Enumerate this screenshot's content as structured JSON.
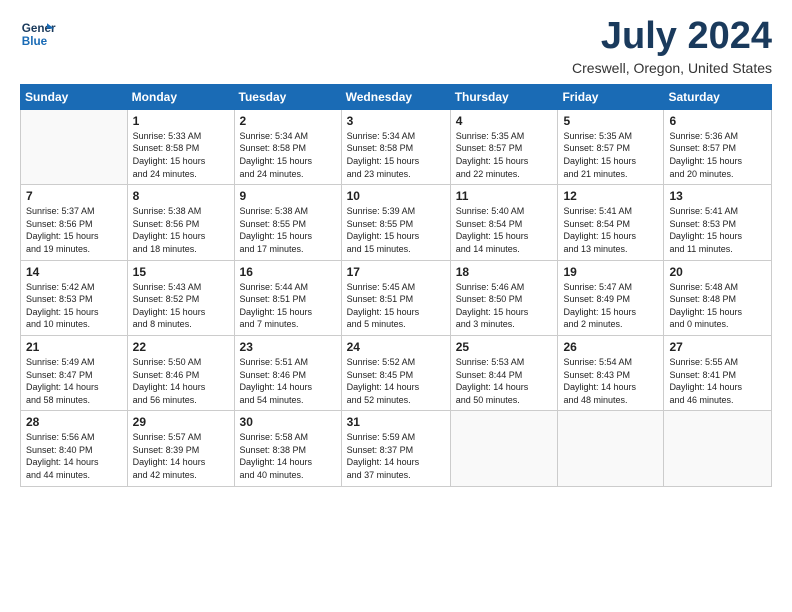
{
  "header": {
    "logo_line1": "General",
    "logo_line2": "Blue",
    "month_title": "July 2024",
    "location": "Creswell, Oregon, United States"
  },
  "weekdays": [
    "Sunday",
    "Monday",
    "Tuesday",
    "Wednesday",
    "Thursday",
    "Friday",
    "Saturday"
  ],
  "weeks": [
    [
      {
        "num": "",
        "info": ""
      },
      {
        "num": "1",
        "info": "Sunrise: 5:33 AM\nSunset: 8:58 PM\nDaylight: 15 hours\nand 24 minutes."
      },
      {
        "num": "2",
        "info": "Sunrise: 5:34 AM\nSunset: 8:58 PM\nDaylight: 15 hours\nand 24 minutes."
      },
      {
        "num": "3",
        "info": "Sunrise: 5:34 AM\nSunset: 8:58 PM\nDaylight: 15 hours\nand 23 minutes."
      },
      {
        "num": "4",
        "info": "Sunrise: 5:35 AM\nSunset: 8:57 PM\nDaylight: 15 hours\nand 22 minutes."
      },
      {
        "num": "5",
        "info": "Sunrise: 5:35 AM\nSunset: 8:57 PM\nDaylight: 15 hours\nand 21 minutes."
      },
      {
        "num": "6",
        "info": "Sunrise: 5:36 AM\nSunset: 8:57 PM\nDaylight: 15 hours\nand 20 minutes."
      }
    ],
    [
      {
        "num": "7",
        "info": "Sunrise: 5:37 AM\nSunset: 8:56 PM\nDaylight: 15 hours\nand 19 minutes."
      },
      {
        "num": "8",
        "info": "Sunrise: 5:38 AM\nSunset: 8:56 PM\nDaylight: 15 hours\nand 18 minutes."
      },
      {
        "num": "9",
        "info": "Sunrise: 5:38 AM\nSunset: 8:55 PM\nDaylight: 15 hours\nand 17 minutes."
      },
      {
        "num": "10",
        "info": "Sunrise: 5:39 AM\nSunset: 8:55 PM\nDaylight: 15 hours\nand 15 minutes."
      },
      {
        "num": "11",
        "info": "Sunrise: 5:40 AM\nSunset: 8:54 PM\nDaylight: 15 hours\nand 14 minutes."
      },
      {
        "num": "12",
        "info": "Sunrise: 5:41 AM\nSunset: 8:54 PM\nDaylight: 15 hours\nand 13 minutes."
      },
      {
        "num": "13",
        "info": "Sunrise: 5:41 AM\nSunset: 8:53 PM\nDaylight: 15 hours\nand 11 minutes."
      }
    ],
    [
      {
        "num": "14",
        "info": "Sunrise: 5:42 AM\nSunset: 8:53 PM\nDaylight: 15 hours\nand 10 minutes."
      },
      {
        "num": "15",
        "info": "Sunrise: 5:43 AM\nSunset: 8:52 PM\nDaylight: 15 hours\nand 8 minutes."
      },
      {
        "num": "16",
        "info": "Sunrise: 5:44 AM\nSunset: 8:51 PM\nDaylight: 15 hours\nand 7 minutes."
      },
      {
        "num": "17",
        "info": "Sunrise: 5:45 AM\nSunset: 8:51 PM\nDaylight: 15 hours\nand 5 minutes."
      },
      {
        "num": "18",
        "info": "Sunrise: 5:46 AM\nSunset: 8:50 PM\nDaylight: 15 hours\nand 3 minutes."
      },
      {
        "num": "19",
        "info": "Sunrise: 5:47 AM\nSunset: 8:49 PM\nDaylight: 15 hours\nand 2 minutes."
      },
      {
        "num": "20",
        "info": "Sunrise: 5:48 AM\nSunset: 8:48 PM\nDaylight: 15 hours\nand 0 minutes."
      }
    ],
    [
      {
        "num": "21",
        "info": "Sunrise: 5:49 AM\nSunset: 8:47 PM\nDaylight: 14 hours\nand 58 minutes."
      },
      {
        "num": "22",
        "info": "Sunrise: 5:50 AM\nSunset: 8:46 PM\nDaylight: 14 hours\nand 56 minutes."
      },
      {
        "num": "23",
        "info": "Sunrise: 5:51 AM\nSunset: 8:46 PM\nDaylight: 14 hours\nand 54 minutes."
      },
      {
        "num": "24",
        "info": "Sunrise: 5:52 AM\nSunset: 8:45 PM\nDaylight: 14 hours\nand 52 minutes."
      },
      {
        "num": "25",
        "info": "Sunrise: 5:53 AM\nSunset: 8:44 PM\nDaylight: 14 hours\nand 50 minutes."
      },
      {
        "num": "26",
        "info": "Sunrise: 5:54 AM\nSunset: 8:43 PM\nDaylight: 14 hours\nand 48 minutes."
      },
      {
        "num": "27",
        "info": "Sunrise: 5:55 AM\nSunset: 8:41 PM\nDaylight: 14 hours\nand 46 minutes."
      }
    ],
    [
      {
        "num": "28",
        "info": "Sunrise: 5:56 AM\nSunset: 8:40 PM\nDaylight: 14 hours\nand 44 minutes."
      },
      {
        "num": "29",
        "info": "Sunrise: 5:57 AM\nSunset: 8:39 PM\nDaylight: 14 hours\nand 42 minutes."
      },
      {
        "num": "30",
        "info": "Sunrise: 5:58 AM\nSunset: 8:38 PM\nDaylight: 14 hours\nand 40 minutes."
      },
      {
        "num": "31",
        "info": "Sunrise: 5:59 AM\nSunset: 8:37 PM\nDaylight: 14 hours\nand 37 minutes."
      },
      {
        "num": "",
        "info": ""
      },
      {
        "num": "",
        "info": ""
      },
      {
        "num": "",
        "info": ""
      }
    ]
  ]
}
